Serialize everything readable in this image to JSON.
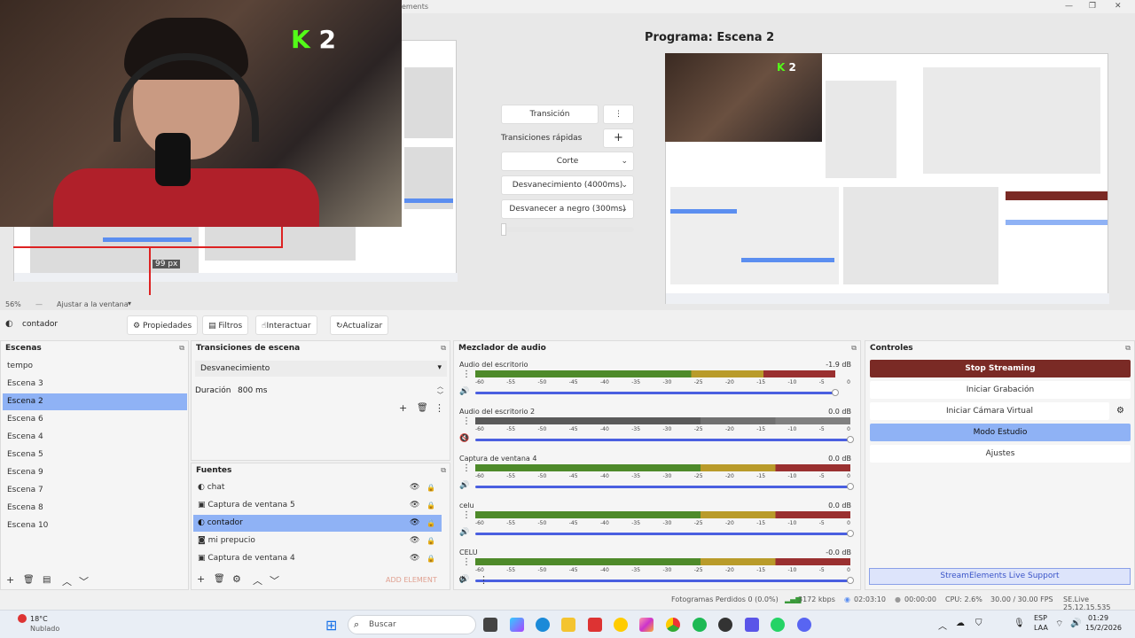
{
  "window": {
    "title_fragment": "ements",
    "controls": [
      "—",
      "❐",
      "✕"
    ]
  },
  "preview": {
    "kick_number": "2",
    "px_label": "99 px",
    "zoom": "56%",
    "zoom_mode": "Ajustar a la ventana"
  },
  "transitions_panel": {
    "transition_button": "Transición",
    "quick_transitions": "Transiciones rápidas",
    "options": [
      "Corte",
      "Desvanecimiento (4000ms)",
      "Desvanecer a negro (300ms)"
    ]
  },
  "program": {
    "title": "Programa: Escena 2",
    "kick_number": "2"
  },
  "source_toolbar": {
    "source_name": "contador",
    "properties": "Propiedades",
    "filters": "Filtros",
    "interact": "Interactuar",
    "refresh": "Actualizar"
  },
  "scenes": {
    "title": "Escenas",
    "items": [
      "tempo",
      "Escena 3",
      "Escena 2",
      "Escena 6",
      "Escena 4",
      "Escena 5",
      "Escena 9",
      "Escena 7",
      "Escena 8",
      "Escena 10"
    ],
    "selected": "Escena 2"
  },
  "scene_transitions": {
    "title": "Transiciones de escena",
    "current": "Desvanecimiento",
    "duration_label": "Duración",
    "duration_value": "800 ms"
  },
  "sources": {
    "title": "Fuentes",
    "items": [
      "chat",
      "Captura de ventana 5",
      "contador",
      "mi prepucio",
      "Captura de ventana 4"
    ],
    "selected": "contador",
    "add_element": "ADD ELEMENT"
  },
  "mixer": {
    "title": "Mezclador de audio",
    "ticks": [
      "-60",
      "-55",
      "-50",
      "-45",
      "-40",
      "-35",
      "-30",
      "-25",
      "-20",
      "-15",
      "-10",
      "-5",
      "0"
    ],
    "channels": [
      {
        "name": "Audio del escritorio",
        "db": "-1.9 dB",
        "level": 0.96,
        "muted": false,
        "volume": 0.96
      },
      {
        "name": "Audio del escritorio 2",
        "db": "0.0 dB",
        "level": 1.0,
        "muted": true,
        "volume": 1.0
      },
      {
        "name": "Captura de ventana 4",
        "db": "0.0 dB",
        "level": 1.0,
        "muted": false,
        "volume": 1.0
      },
      {
        "name": "celu",
        "db": "0.0 dB",
        "level": 1.0,
        "muted": false,
        "volume": 1.0
      },
      {
        "name": "CELU",
        "db": "-0.0 dB",
        "level": 1.0,
        "muted": false,
        "volume": 1.0
      }
    ]
  },
  "controls": {
    "title": "Controles",
    "stop_streaming": "Stop Streaming",
    "start_recording": "Iniciar Grabación",
    "virtual_camera": "Iniciar Cámara Virtual",
    "studio_mode": "Modo Estudio",
    "settings": "Ajustes",
    "se_support": "StreamElements Live Support"
  },
  "status": {
    "dropped_frames": "Fotogramas Perdidos 0 (0.0%)",
    "bitrate": "3172 kbps",
    "stream_time": "02:03:10",
    "rec_time": "00:00:00",
    "cpu": "CPU: 2.6%",
    "fps": "30.00 / 30.00 FPS",
    "version": "SE.Live 25.12.15.535"
  },
  "taskbar": {
    "weather_temp": "18°C",
    "weather_desc": "Nublado",
    "search": "Buscar",
    "lang1": "ESP",
    "lang2": "LAA",
    "time": "01:29",
    "date": "15/2/2026"
  },
  "colors": {
    "accent_selected": "#8fb2f5",
    "stop_streaming": "#7a2a25",
    "volume": "#4a5fe0",
    "kick_green": "#53fc18"
  }
}
